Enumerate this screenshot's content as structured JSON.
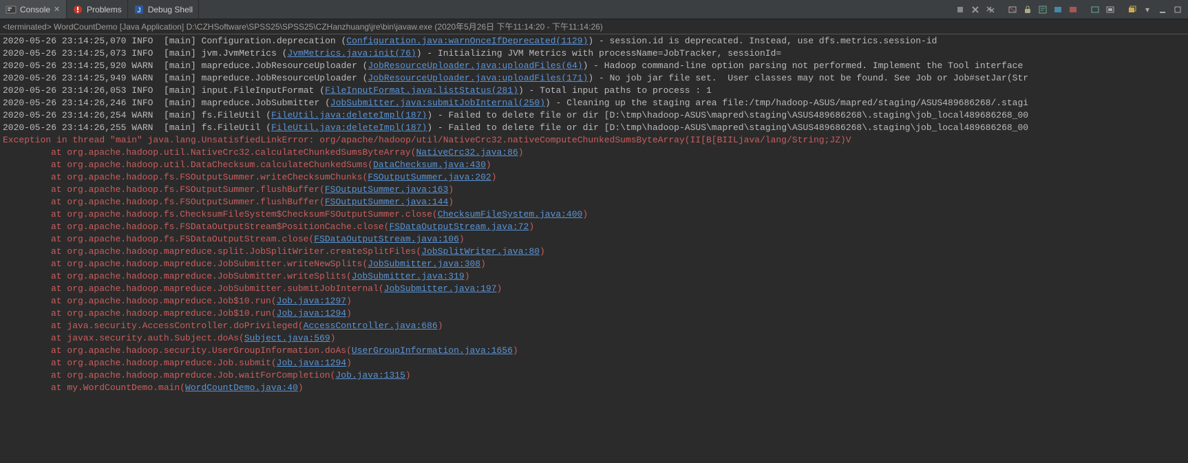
{
  "tabs": {
    "console": "Console",
    "problems": "Problems",
    "debug_shell": "Debug Shell"
  },
  "terminated": "<terminated> WordCountDemo [Java Application] D:\\CZHSoftware\\SPSS25\\SPSS25\\CZHanzhuang\\jre\\bin\\javaw.exe  (2020年5月26日 下午11:14:20 - 下午11:14:26)",
  "lines": [
    {
      "pre": "2020-05-26 23:14:25,070 INFO  [main] Configuration.deprecation (",
      "link": "Configuration.java:warnOnceIfDeprecated(1129)",
      "post": ") - session.id is deprecated. Instead, use dfs.metrics.session-id"
    },
    {
      "pre": "2020-05-26 23:14:25,073 INFO  [main] jvm.JvmMetrics (",
      "link": "JvmMetrics.java:init(76)",
      "post": ") - Initializing JVM Metrics with processName=JobTracker, sessionId="
    },
    {
      "pre": "2020-05-26 23:14:25,920 WARN  [main] mapreduce.JobResourceUploader (",
      "link": "JobResourceUploader.java:uploadFiles(64)",
      "post": ") - Hadoop command-line option parsing not performed. Implement the Tool interface"
    },
    {
      "pre": "2020-05-26 23:14:25,949 WARN  [main] mapreduce.JobResourceUploader (",
      "link": "JobResourceUploader.java:uploadFiles(171)",
      "post": ") - No job jar file set.  User classes may not be found. See Job or Job#setJar(Str"
    },
    {
      "pre": "2020-05-26 23:14:26,053 INFO  [main] input.FileInputFormat (",
      "link": "FileInputFormat.java:listStatus(281)",
      "post": ") - Total input paths to process : 1"
    },
    {
      "pre": "2020-05-26 23:14:26,246 INFO  [main] mapreduce.JobSubmitter (",
      "link": "JobSubmitter.java:submitJobInternal(250)",
      "post": ") - Cleaning up the staging area file:/tmp/hadoop-ASUS/mapred/staging/ASUS489686268/.stagi"
    },
    {
      "pre": "2020-05-26 23:14:26,254 WARN  [main] fs.FileUtil (",
      "link": "FileUtil.java:deleteImpl(187)",
      "post": ") - Failed to delete file or dir [D:\\tmp\\hadoop-ASUS\\mapred\\staging\\ASUS489686268\\.staging\\job_local489686268_00"
    },
    {
      "pre": "2020-05-26 23:14:26,255 WARN  [main] fs.FileUtil (",
      "link": "FileUtil.java:deleteImpl(187)",
      "post": ") - Failed to delete file or dir [D:\\tmp\\hadoop-ASUS\\mapred\\staging\\ASUS489686268\\.staging\\job_local489686268_00"
    }
  ],
  "exception_header": "Exception in thread \"main\" java.lang.UnsatisfiedLinkError: org/apache/hadoop/util/NativeCrc32.nativeComputeChunkedSumsByteArray(II[B[BIILjava/lang/String;JZ)V",
  "stack": [
    {
      "pre": "at org.apache.hadoop.util.NativeCrc32.calculateChunkedSumsByteArray(",
      "link": "NativeCrc32.java:86",
      "post": ")"
    },
    {
      "pre": "at org.apache.hadoop.util.DataChecksum.calculateChunkedSums(",
      "link": "DataChecksum.java:430",
      "post": ")"
    },
    {
      "pre": "at org.apache.hadoop.fs.FSOutputSummer.writeChecksumChunks(",
      "link": "FSOutputSummer.java:202",
      "post": ")"
    },
    {
      "pre": "at org.apache.hadoop.fs.FSOutputSummer.flushBuffer(",
      "link": "FSOutputSummer.java:163",
      "post": ")"
    },
    {
      "pre": "at org.apache.hadoop.fs.FSOutputSummer.flushBuffer(",
      "link": "FSOutputSummer.java:144",
      "post": ")"
    },
    {
      "pre": "at org.apache.hadoop.fs.ChecksumFileSystem$ChecksumFSOutputSummer.close(",
      "link": "ChecksumFileSystem.java:400",
      "post": ")"
    },
    {
      "pre": "at org.apache.hadoop.fs.FSDataOutputStream$PositionCache.close(",
      "link": "FSDataOutputStream.java:72",
      "post": ")"
    },
    {
      "pre": "at org.apache.hadoop.fs.FSDataOutputStream.close(",
      "link": "FSDataOutputStream.java:106",
      "post": ")"
    },
    {
      "pre": "at org.apache.hadoop.mapreduce.split.JobSplitWriter.createSplitFiles(",
      "link": "JobSplitWriter.java:80",
      "post": ")"
    },
    {
      "pre": "at org.apache.hadoop.mapreduce.JobSubmitter.writeNewSplits(",
      "link": "JobSubmitter.java:308",
      "post": ")"
    },
    {
      "pre": "at org.apache.hadoop.mapreduce.JobSubmitter.writeSplits(",
      "link": "JobSubmitter.java:319",
      "post": ")"
    },
    {
      "pre": "at org.apache.hadoop.mapreduce.JobSubmitter.submitJobInternal(",
      "link": "JobSubmitter.java:197",
      "post": ")"
    },
    {
      "pre": "at org.apache.hadoop.mapreduce.Job$10.run(",
      "link": "Job.java:1297",
      "post": ")"
    },
    {
      "pre": "at org.apache.hadoop.mapreduce.Job$10.run(",
      "link": "Job.java:1294",
      "post": ")"
    },
    {
      "pre": "at java.security.AccessController.doPrivileged(",
      "link": "AccessController.java:686",
      "post": ")"
    },
    {
      "pre": "at javax.security.auth.Subject.doAs(",
      "link": "Subject.java:569",
      "post": ")"
    },
    {
      "pre": "at org.apache.hadoop.security.UserGroupInformation.doAs(",
      "link": "UserGroupInformation.java:1656",
      "post": ")"
    },
    {
      "pre": "at org.apache.hadoop.mapreduce.Job.submit(",
      "link": "Job.java:1294",
      "post": ")"
    },
    {
      "pre": "at org.apache.hadoop.mapreduce.Job.waitForCompletion(",
      "link": "Job.java:1315",
      "post": ")"
    },
    {
      "pre": "at my.WordCountDemo.main(",
      "link": "WordCountDemo.java:40",
      "post": ")"
    }
  ],
  "toolbar_icons": [
    "terminate",
    "remove-all",
    "sep",
    "clear",
    "scroll-lock",
    "pin",
    "wrap",
    "show-console",
    "sep",
    "display",
    "open-console",
    "sep",
    "menu",
    "min",
    "max"
  ]
}
